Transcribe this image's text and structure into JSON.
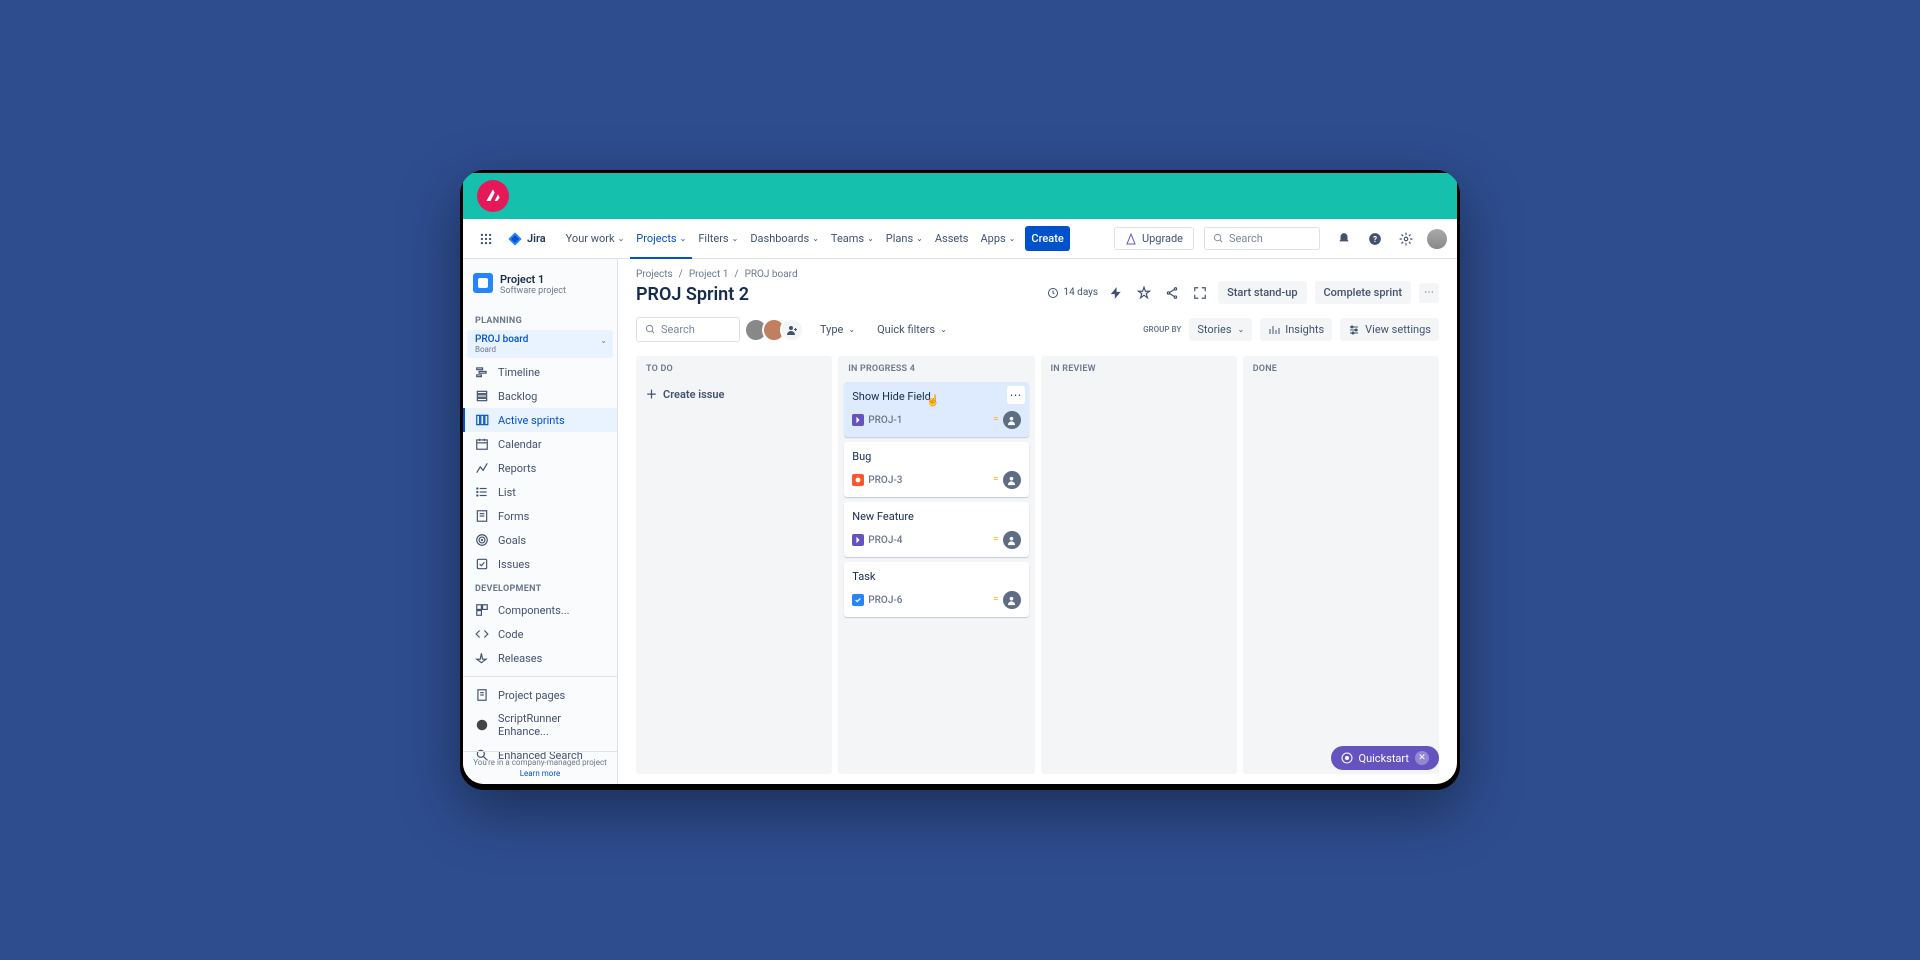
{
  "brand": {
    "name": "Atlassian"
  },
  "topnav": {
    "product": "Jira",
    "items": [
      {
        "label": "Your work",
        "dropdown": true
      },
      {
        "label": "Projects",
        "dropdown": true,
        "active": true
      },
      {
        "label": "Filters",
        "dropdown": true
      },
      {
        "label": "Dashboards",
        "dropdown": true
      },
      {
        "label": "Teams",
        "dropdown": true
      },
      {
        "label": "Plans",
        "dropdown": true
      },
      {
        "label": "Assets",
        "dropdown": false
      },
      {
        "label": "Apps",
        "dropdown": true
      }
    ],
    "create": "Create",
    "upgrade": "Upgrade",
    "search_placeholder": "Search"
  },
  "sidebar": {
    "project": {
      "name": "Project 1",
      "type": "Software project"
    },
    "board_group": {
      "name": "PROJ board",
      "subtitle": "Board"
    },
    "section_planning": "PLANNING",
    "planning_items": [
      "Timeline",
      "Backlog",
      "Active sprints",
      "Calendar",
      "Reports",
      "List",
      "Forms",
      "Goals",
      "Issues"
    ],
    "section_development": "DEVELOPMENT",
    "dev_items": [
      "Components...",
      "Code",
      "Releases"
    ],
    "extra_items": [
      "Project pages",
      "ScriptRunner Enhance...",
      "Enhanced Search"
    ],
    "footer_text": "You're in a company-managed project",
    "footer_link": "Learn more"
  },
  "breadcrumb": [
    "Projects",
    "Project 1",
    "PROJ board"
  ],
  "page_title": "PROJ Sprint 2",
  "title_actions": {
    "days": "14 days",
    "standup": "Start stand-up",
    "complete": "Complete sprint"
  },
  "controls": {
    "search_placeholder": "Search",
    "type": "Type",
    "quick_filters": "Quick filters",
    "group_by_label": "GROUP BY",
    "group_by_value": "Stories",
    "insights": "Insights",
    "view_settings": "View settings"
  },
  "columns": [
    {
      "title": "TO DO",
      "count": "",
      "create": "Create issue",
      "cards": []
    },
    {
      "title": "IN PROGRESS",
      "count": "4",
      "cards": [
        {
          "title": "Show Hide Field",
          "key": "PROJ-1",
          "type": "epic",
          "highlighted": true,
          "menu": true
        },
        {
          "title": "Bug",
          "key": "PROJ-3",
          "type": "bug"
        },
        {
          "title": "New Feature",
          "key": "PROJ-4",
          "type": "epic"
        },
        {
          "title": "Task",
          "key": "PROJ-6",
          "type": "task"
        }
      ]
    },
    {
      "title": "IN REVIEW",
      "count": "",
      "cards": []
    },
    {
      "title": "DONE",
      "count": "",
      "cards": []
    }
  ],
  "quickstart": {
    "label": "Quickstart"
  }
}
